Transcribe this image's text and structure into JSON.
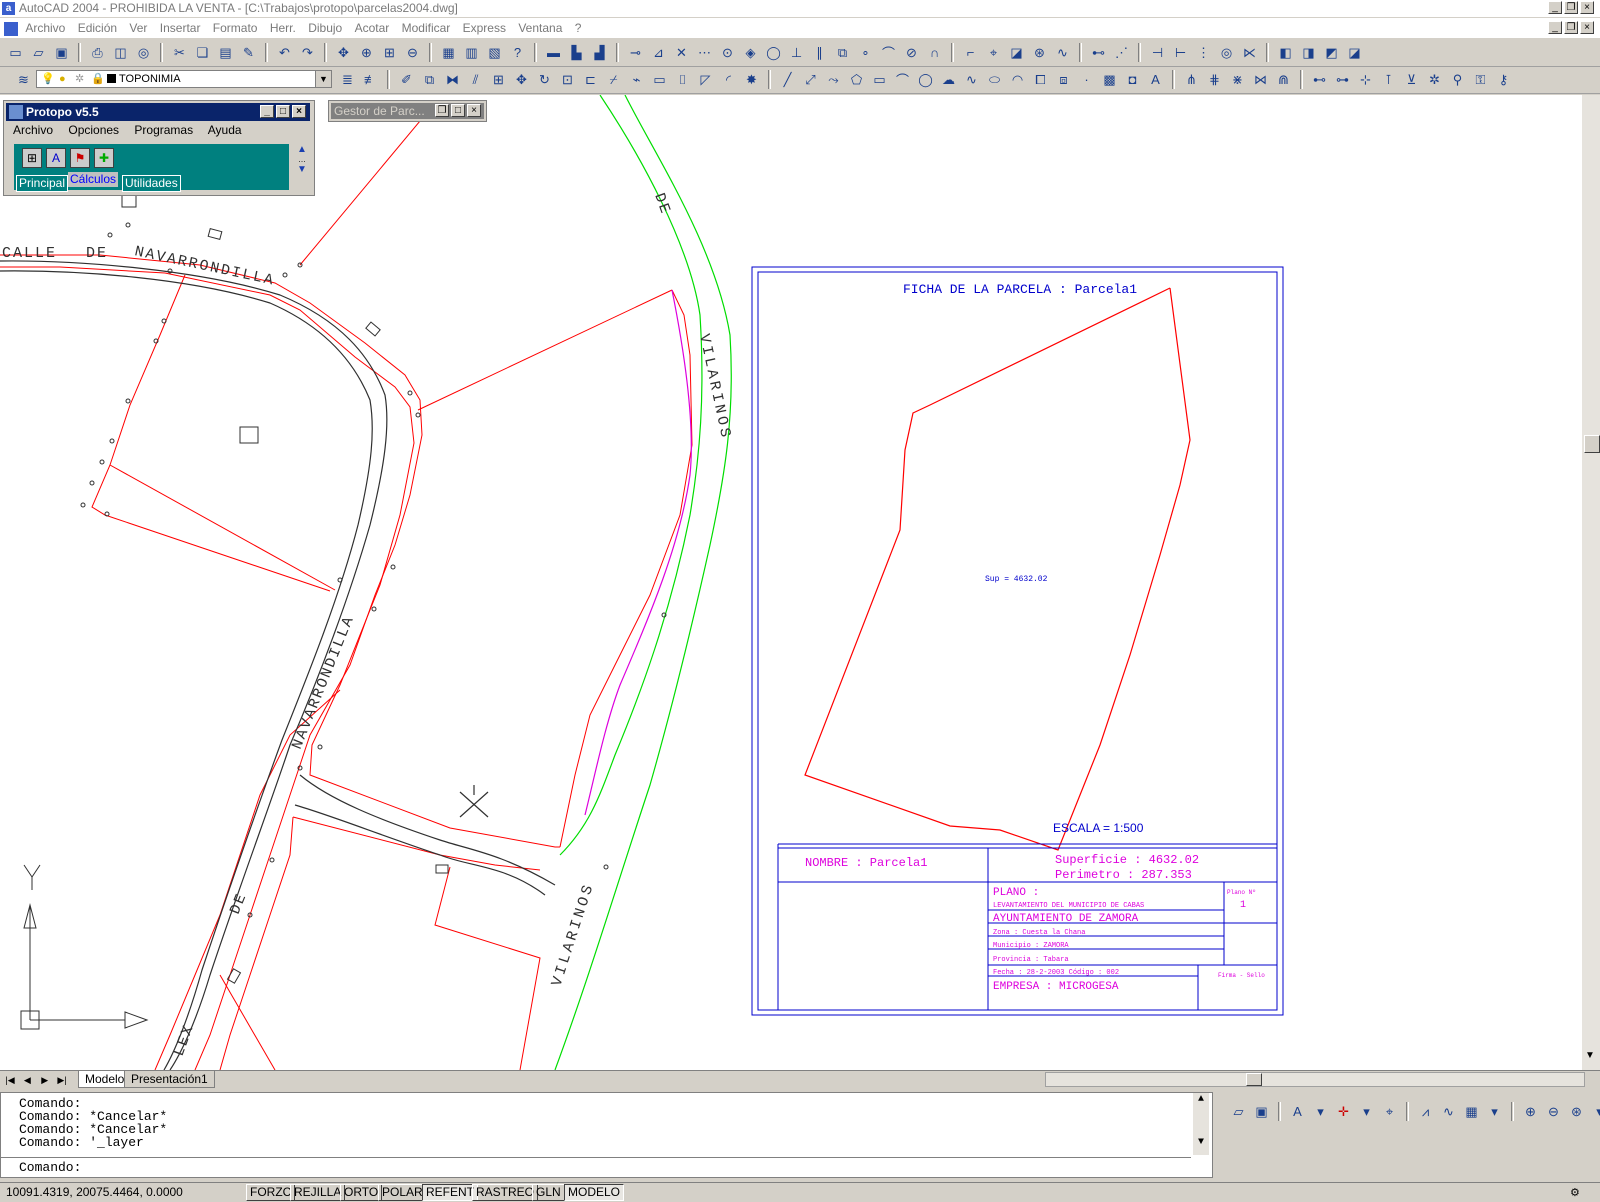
{
  "window": {
    "title": "AutoCAD 2004 - PROHIBIDA LA VENTA - [C:\\Trabajos\\protopo\\parcelas2004.dwg]"
  },
  "menu": [
    "Archivo",
    "Edición",
    "Ver",
    "Insertar",
    "Formato",
    "Herr.",
    "Dibujo",
    "Acotar",
    "Modificar",
    "Express",
    "Ventana",
    "?"
  ],
  "layer": {
    "current": "TOPONIMIA"
  },
  "protopo": {
    "title": "Protopo v5.5",
    "menu": [
      "Archivo",
      "Opciones",
      "Programas",
      "Ayuda"
    ],
    "tabs": [
      "Principal",
      "Cálculos",
      "Utilidades"
    ]
  },
  "gestor": {
    "title": "Gestor de Parc..."
  },
  "drawing": {
    "street_calle": "CALLE",
    "street_de": "DE",
    "street_navarrondilla": "NAVARRONDILLA",
    "street_navarrondilla_v": "NAVARRONDILLA",
    "street_vilarinos": "VILARINOS",
    "street_vilarinos_2": "VILARINOS",
    "street_de_2": "DE",
    "street_de_3": "DE",
    "street_lex": "LEX"
  },
  "ficha": {
    "title": "FICHA DE LA PARCELA : Parcela1",
    "superficie_label": "Sup = 4632.02",
    "escala": "ESCALA =   1:500",
    "nombre": "NOMBRE : Parcela1",
    "superficie": "Superficie  : 4632.02",
    "perimetro": "Perimetro   : 287.353",
    "plano": "PLANO :",
    "levantamiento": "LEVANTAMIENTO DEL MUNICIPIO DE CABAS",
    "ayuntamiento": "AYUNTAMIENTO DE ZAMORA",
    "zona": "Zona        : Cuesta la Chana",
    "municipio": "Municipio   : ZAMORA",
    "provincia": "Provincia   : Tabara",
    "fecha": "Fecha       : 28-2-2003   Código : 002",
    "empresa": "EMPRESA : MICROGESA",
    "plano_n_label": "Plano Nº",
    "plano_n": "1",
    "firma": "Firma - Sello"
  },
  "tabs": [
    "Modelo",
    "Presentación1"
  ],
  "command_history": [
    "Comando:",
    "Comando: *Cancelar*",
    "Comando: *Cancelar*",
    "Comando: '_layer"
  ],
  "command_prompt": "Comando:",
  "status": {
    "coords": "10091.4319, 20075.4464, 0.0000",
    "buttons": [
      "FORZC",
      "REJILLA",
      "ORTO",
      "POLAR",
      "REFENT",
      "RASTREO",
      "GLN",
      "MODELO"
    ]
  },
  "ucs": {
    "y_label": "Y"
  },
  "colors": {
    "parcel": "#ff0000",
    "road": "#404040",
    "green": "#00dd00",
    "magenta": "#dd00dd",
    "frame_blue": "#0000cc"
  }
}
